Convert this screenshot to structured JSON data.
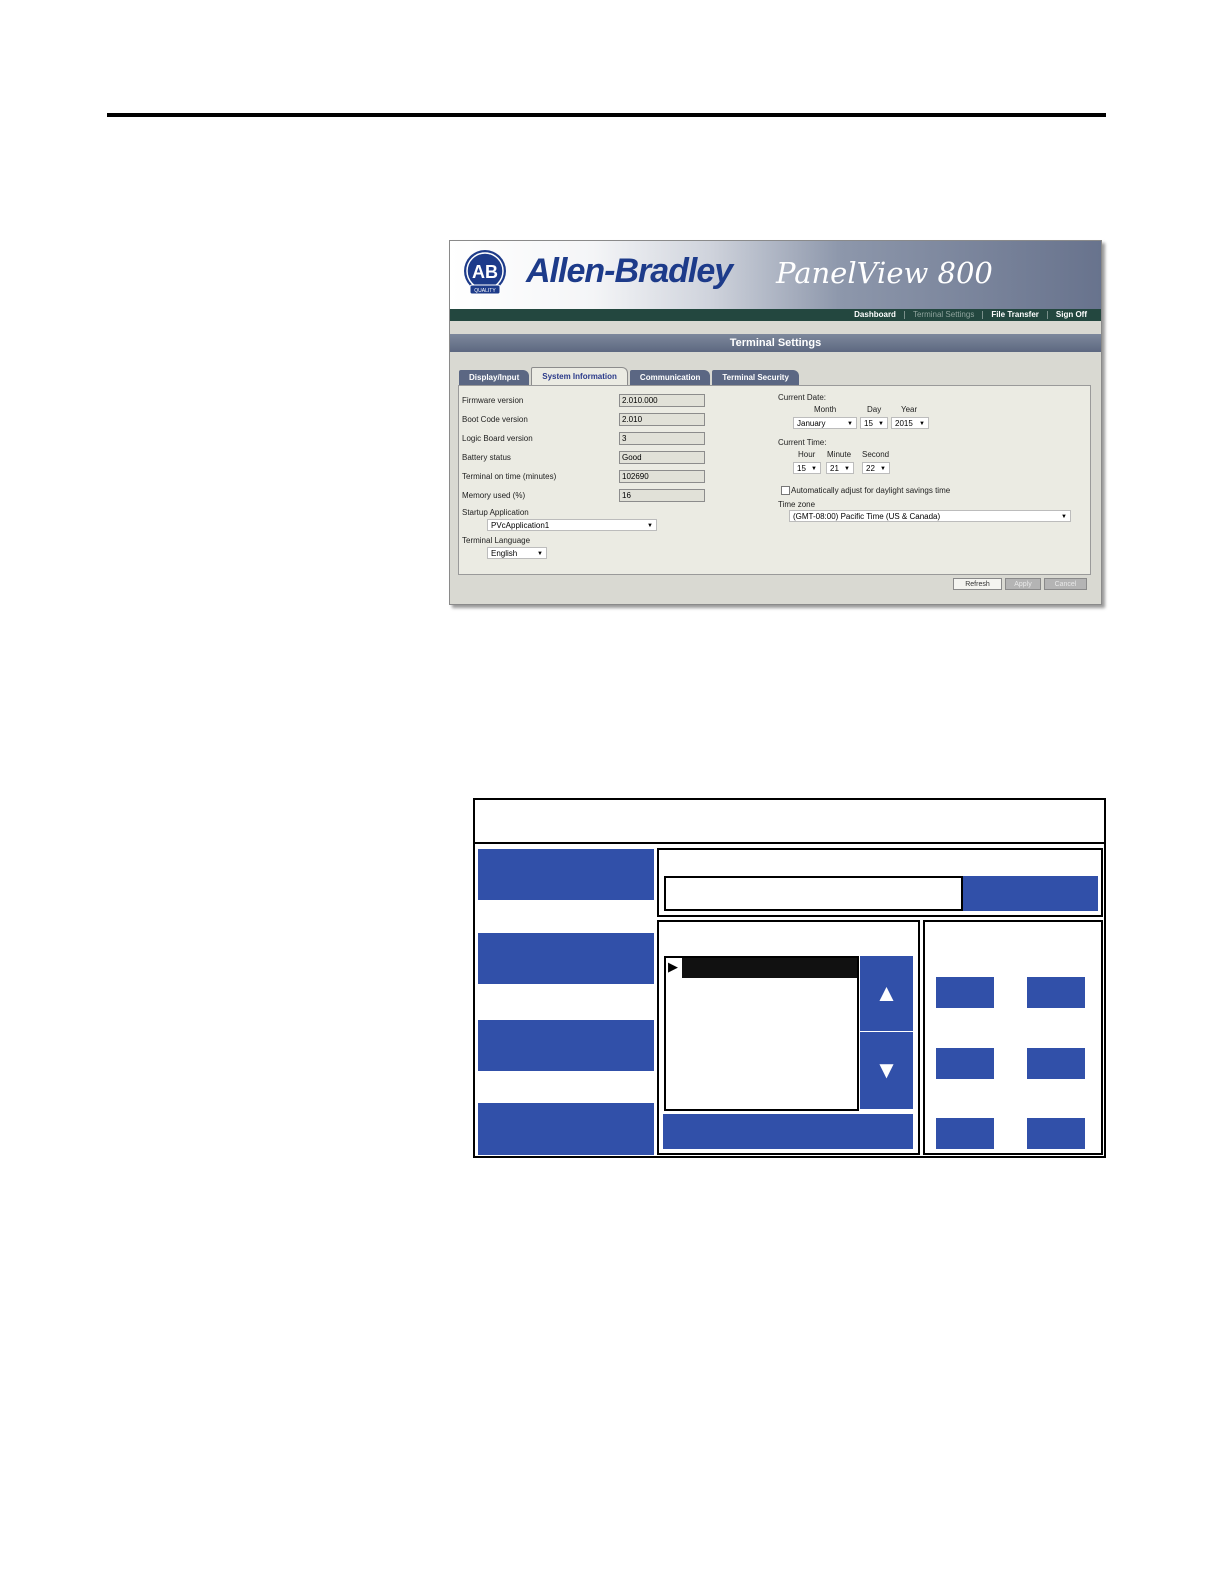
{
  "panelview": {
    "brand": "Allen-Bradley",
    "logo_text": "AB",
    "logo_quality": "QUALITY",
    "product": "PanelView 800",
    "nav": [
      "Dashboard",
      "Terminal Settings",
      "File Transfer",
      "Sign Off"
    ],
    "active_nav": "Terminal Settings",
    "page_title": "Terminal Settings",
    "tabs": [
      "Display/Input",
      "System Information",
      "Communication",
      "Terminal Security"
    ],
    "active_tab": "System Information",
    "fields": {
      "firmware_version_label": "Firmware version",
      "firmware_version": "2.010.000",
      "boot_code_label": "Boot Code version",
      "boot_code": "2.010",
      "logic_board_label": "Logic Board version",
      "logic_board": "3",
      "battery_label": "Battery status",
      "battery": "Good",
      "on_time_label": "Terminal on time (minutes)",
      "on_time": "102690",
      "memory_label": "Memory used (%)",
      "memory": "16",
      "startup_label": "Startup Application",
      "startup": "PVcApplication1",
      "language_label": "Terminal Language",
      "language": "English"
    },
    "date": {
      "label": "Current Date:",
      "month_label": "Month",
      "day_label": "Day",
      "year_label": "Year",
      "month": "January",
      "day": "15",
      "year": "2015"
    },
    "time": {
      "label": "Current Time:",
      "hour_label": "Hour",
      "minute_label": "Minute",
      "second_label": "Second",
      "hour": "15",
      "minute": "21",
      "second": "22"
    },
    "dst_label": "Automatically adjust for daylight savings time",
    "timezone_label": "Time zone",
    "timezone": "(GMT-08:00) Pacific Time (US & Canada)",
    "buttons": {
      "refresh": "Refresh",
      "apply": "Apply",
      "cancel": "Cancel"
    }
  },
  "colors": {
    "diagram_blue": "#3150a9",
    "nav_green": "#23473f",
    "brand_blue": "#1d3b8a"
  },
  "diagram_icons": {
    "up": "▲",
    "down": "▼",
    "pointer": "▶"
  }
}
